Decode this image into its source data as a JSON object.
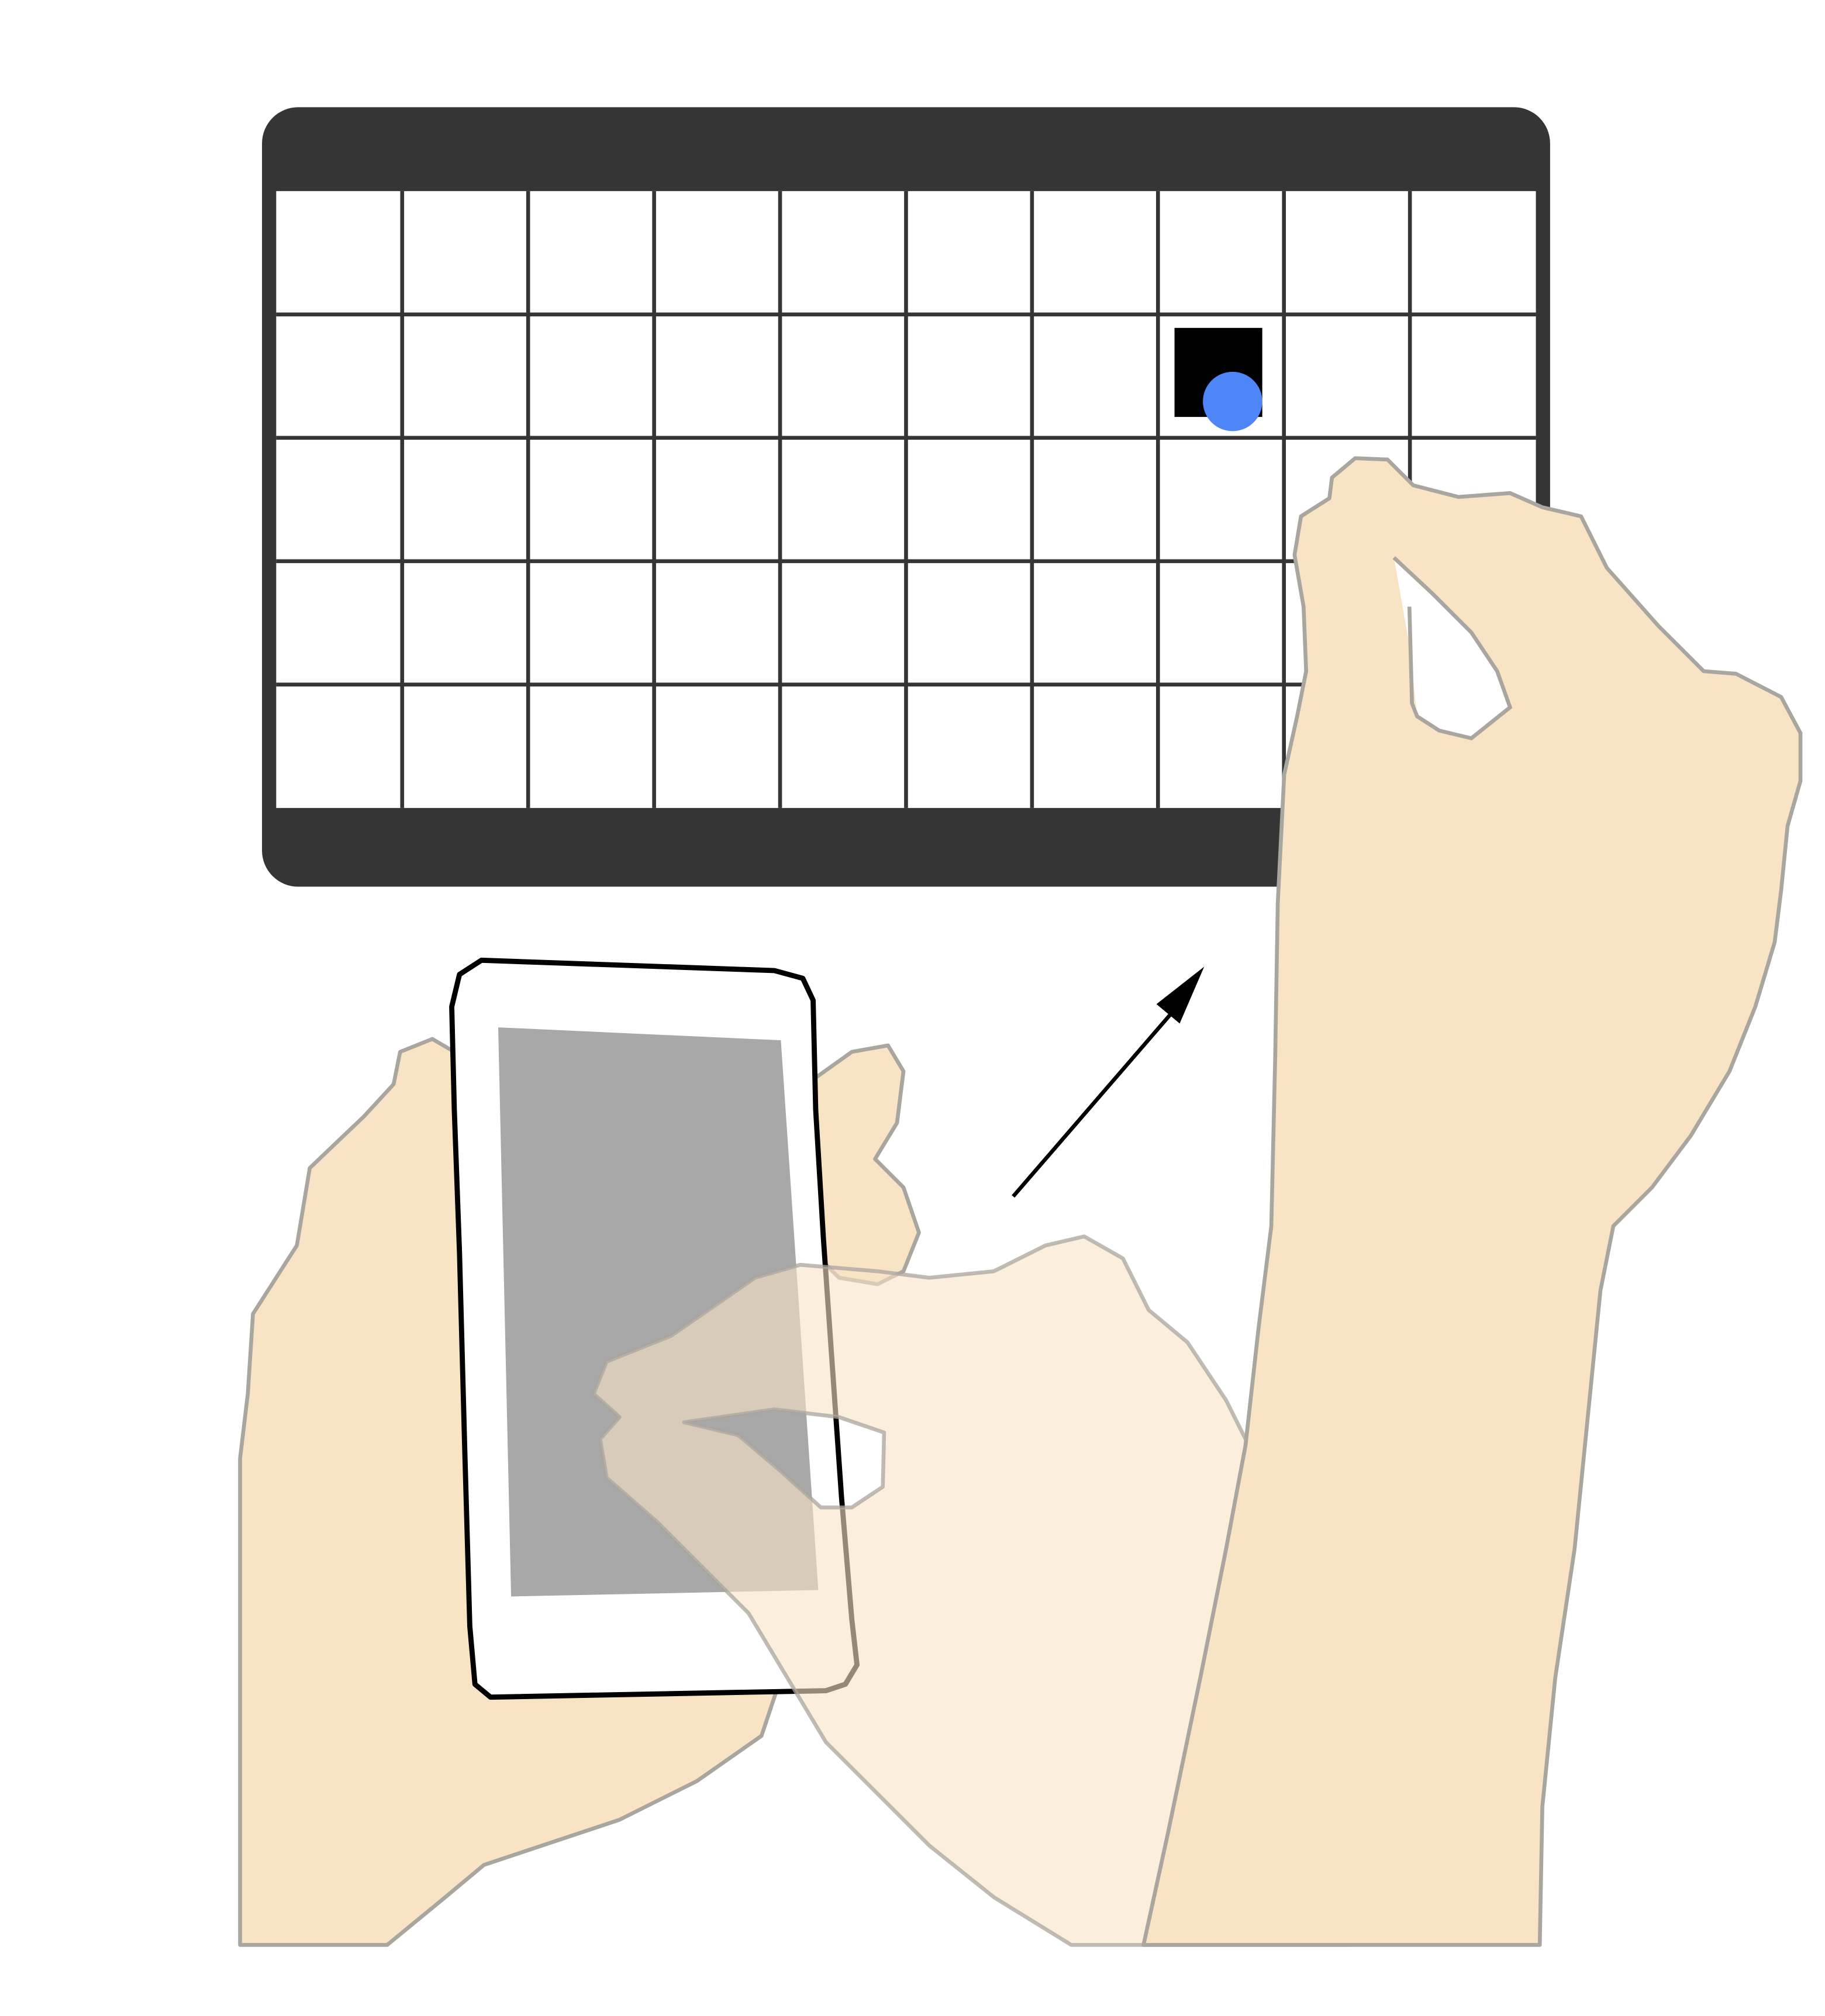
{
  "colors": {
    "background": "#ffffff",
    "display_frame": "#353535",
    "grid_cell": "#ffffff",
    "grid_line": "#353535",
    "target_square": "#000000",
    "cursor_dot": "#4f86f7",
    "skin": "#f8e3c5",
    "skin_outline": "#a9a59f",
    "phone_body": "#ffffff",
    "phone_outline": "#000000",
    "phone_screen": "#a8a8a8",
    "arrow": "#000000"
  },
  "grid": {
    "columns": 10,
    "rows": 5,
    "target_cell": {
      "row": 2,
      "column": 8
    }
  },
  "icons": {
    "display": "large-display-icon",
    "phone": "smartphone-icon",
    "cursor": "cursor-dot-icon",
    "arrow": "arrow-icon",
    "hands": "hand-icon"
  }
}
